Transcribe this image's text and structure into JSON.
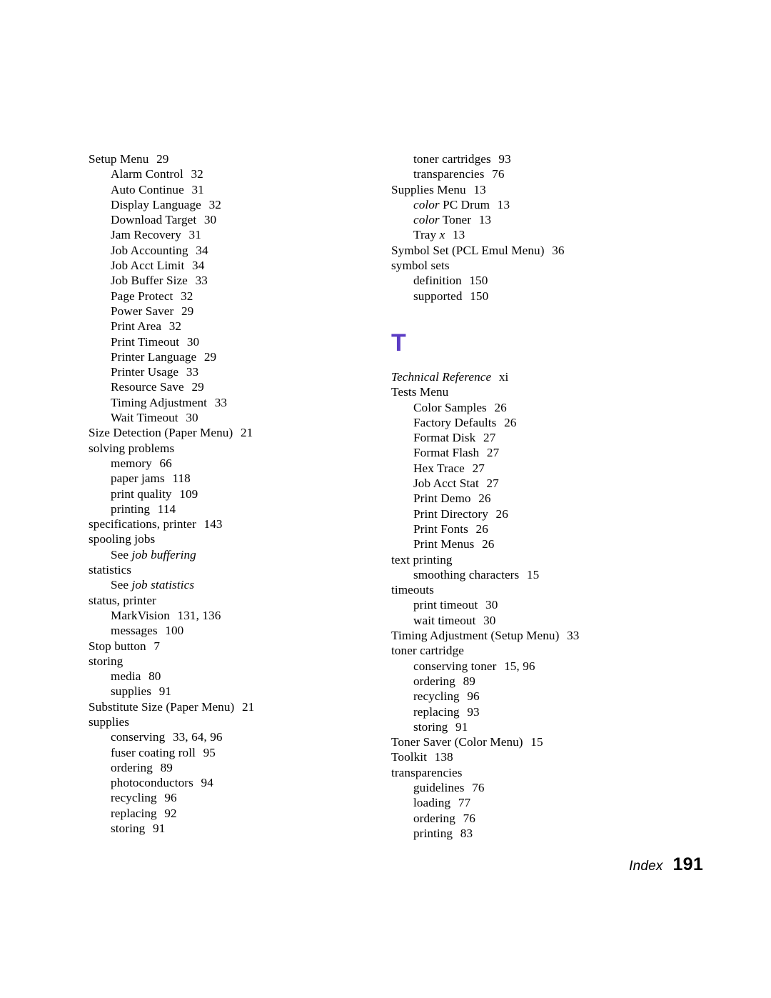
{
  "document": {
    "type": "index-page",
    "footer_label": "Index",
    "page_number": "191",
    "accent_color": "#5b3cc4"
  },
  "columns": [
    {
      "name": "left-column",
      "blocks": [
        {
          "type": "entries",
          "items": [
            {
              "level": 1,
              "term": "Setup Menu",
              "pages": "29"
            },
            {
              "level": 2,
              "term": "Alarm Control",
              "pages": "32"
            },
            {
              "level": 2,
              "term": "Auto Continue",
              "pages": "31"
            },
            {
              "level": 2,
              "term": "Display Language",
              "pages": "32"
            },
            {
              "level": 2,
              "term": "Download Target",
              "pages": "30"
            },
            {
              "level": 2,
              "term": "Jam Recovery",
              "pages": "31"
            },
            {
              "level": 2,
              "term": "Job Accounting",
              "pages": "34"
            },
            {
              "level": 2,
              "term": "Job Acct Limit",
              "pages": "34"
            },
            {
              "level": 2,
              "term": "Job Buffer Size",
              "pages": "33"
            },
            {
              "level": 2,
              "term": "Page Protect",
              "pages": "32"
            },
            {
              "level": 2,
              "term": "Power Saver",
              "pages": "29"
            },
            {
              "level": 2,
              "term": "Print Area",
              "pages": "32"
            },
            {
              "level": 2,
              "term": "Print Timeout",
              "pages": "30"
            },
            {
              "level": 2,
              "term": "Printer Language",
              "pages": "29"
            },
            {
              "level": 2,
              "term": "Printer Usage",
              "pages": "33"
            },
            {
              "level": 2,
              "term": "Resource Save",
              "pages": "29"
            },
            {
              "level": 2,
              "term": "Timing Adjustment",
              "pages": "33"
            },
            {
              "level": 2,
              "term": "Wait Timeout",
              "pages": "30"
            },
            {
              "level": 1,
              "term": "Size Detection (Paper Menu)",
              "pages": "21"
            },
            {
              "level": 1,
              "term": "solving problems",
              "pages": ""
            },
            {
              "level": 2,
              "term": "memory",
              "pages": "66"
            },
            {
              "level": 2,
              "term": "paper jams",
              "pages": "118"
            },
            {
              "level": 2,
              "term": "print quality",
              "pages": "109"
            },
            {
              "level": 2,
              "term": "printing",
              "pages": "114"
            },
            {
              "level": 1,
              "term": "specifications, printer",
              "pages": "143"
            },
            {
              "level": 1,
              "term": "spooling jobs",
              "pages": ""
            },
            {
              "level": 2,
              "xref": true,
              "see": "See",
              "target": "job buffering",
              "pages": ""
            },
            {
              "level": 1,
              "term": "statistics",
              "pages": ""
            },
            {
              "level": 2,
              "xref": true,
              "see": "See",
              "target": "job statistics",
              "pages": ""
            },
            {
              "level": 1,
              "term": "status, printer",
              "pages": ""
            },
            {
              "level": 2,
              "term": "MarkVision",
              "pages": "131, 136"
            },
            {
              "level": 2,
              "term": "messages",
              "pages": "100"
            },
            {
              "level": 1,
              "term": "Stop button",
              "pages": "7"
            },
            {
              "level": 1,
              "term": "storing",
              "pages": ""
            },
            {
              "level": 2,
              "term": "media",
              "pages": "80"
            },
            {
              "level": 2,
              "term": "supplies",
              "pages": "91"
            },
            {
              "level": 1,
              "term": "Substitute Size (Paper Menu)",
              "pages": "21"
            },
            {
              "level": 1,
              "term": "supplies",
              "pages": ""
            },
            {
              "level": 2,
              "term": "conserving",
              "pages": "33, 64, 96"
            },
            {
              "level": 2,
              "term": "fuser coating roll",
              "pages": "95"
            },
            {
              "level": 2,
              "term": "ordering",
              "pages": "89"
            },
            {
              "level": 2,
              "term": "photoconductors",
              "pages": "94"
            },
            {
              "level": 2,
              "term": "recycling",
              "pages": "96"
            },
            {
              "level": 2,
              "term": "replacing",
              "pages": "92"
            },
            {
              "level": 2,
              "term": "storing",
              "pages": "91"
            }
          ]
        }
      ]
    },
    {
      "name": "right-column",
      "blocks": [
        {
          "type": "entries",
          "items": [
            {
              "level": 2,
              "term": "toner cartridges",
              "pages": "93"
            },
            {
              "level": 2,
              "term": "transparencies",
              "pages": "76"
            },
            {
              "level": 1,
              "term": "Supplies Menu",
              "pages": "13"
            },
            {
              "level": 2,
              "term_html": "<i>color</i> PC Drum",
              "pages": "13"
            },
            {
              "level": 2,
              "term_html": "<i>color</i> Toner",
              "pages": "13"
            },
            {
              "level": 2,
              "term_html": "Tray <i>x</i>",
              "pages": "13"
            },
            {
              "level": 1,
              "term": "Symbol Set (PCL Emul Menu)",
              "pages": "36"
            },
            {
              "level": 1,
              "term": "symbol sets",
              "pages": ""
            },
            {
              "level": 2,
              "term": "definition",
              "pages": "150"
            },
            {
              "level": 2,
              "term": "supported",
              "pages": "150"
            }
          ]
        },
        {
          "type": "section-letter",
          "letter": "T"
        },
        {
          "type": "entries",
          "items": [
            {
              "level": 1,
              "term_html": "<i>Technical Reference</i>",
              "pages": "xi"
            },
            {
              "level": 1,
              "term": "Tests Menu",
              "pages": ""
            },
            {
              "level": 2,
              "term": "Color Samples",
              "pages": "26"
            },
            {
              "level": 2,
              "term": "Factory Defaults",
              "pages": "26"
            },
            {
              "level": 2,
              "term": "Format Disk",
              "pages": "27"
            },
            {
              "level": 2,
              "term": "Format Flash",
              "pages": "27"
            },
            {
              "level": 2,
              "term": "Hex Trace",
              "pages": "27"
            },
            {
              "level": 2,
              "term": "Job Acct Stat",
              "pages": "27"
            },
            {
              "level": 2,
              "term": "Print Demo",
              "pages": "26"
            },
            {
              "level": 2,
              "term": "Print Directory",
              "pages": "26"
            },
            {
              "level": 2,
              "term": "Print Fonts",
              "pages": "26"
            },
            {
              "level": 2,
              "term": "Print Menus",
              "pages": "26"
            },
            {
              "level": 1,
              "term": "text printing",
              "pages": ""
            },
            {
              "level": 2,
              "term": "smoothing characters",
              "pages": "15"
            },
            {
              "level": 1,
              "term": "timeouts",
              "pages": ""
            },
            {
              "level": 2,
              "term": "print timeout",
              "pages": "30"
            },
            {
              "level": 2,
              "term": "wait timeout",
              "pages": "30"
            },
            {
              "level": 1,
              "term": "Timing Adjustment (Setup Menu)",
              "pages": "33"
            },
            {
              "level": 1,
              "term": "toner cartridge",
              "pages": ""
            },
            {
              "level": 2,
              "term": "conserving toner",
              "pages": "15, 96"
            },
            {
              "level": 2,
              "term": "ordering",
              "pages": "89"
            },
            {
              "level": 2,
              "term": "recycling",
              "pages": "96"
            },
            {
              "level": 2,
              "term": "replacing",
              "pages": "93"
            },
            {
              "level": 2,
              "term": "storing",
              "pages": "91"
            },
            {
              "level": 1,
              "term": "Toner Saver (Color Menu)",
              "pages": "15"
            },
            {
              "level": 1,
              "term": "Toolkit",
              "pages": "138"
            },
            {
              "level": 1,
              "term": "transparencies",
              "pages": ""
            },
            {
              "level": 2,
              "term": "guidelines",
              "pages": "76"
            },
            {
              "level": 2,
              "term": "loading",
              "pages": "77"
            },
            {
              "level": 2,
              "term": "ordering",
              "pages": "76"
            },
            {
              "level": 2,
              "term": "printing",
              "pages": "83"
            }
          ]
        }
      ]
    }
  ]
}
